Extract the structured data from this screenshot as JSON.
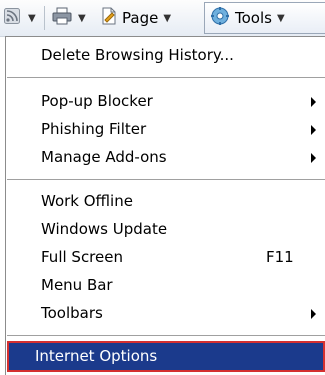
{
  "toolbar": {
    "feeds_icon": "rss-feed-icon",
    "print_icon": "printer-icon",
    "page_icon": "page-icon",
    "page_label": "Page",
    "tools_icon": "gear-icon",
    "tools_label": "Tools"
  },
  "menu": {
    "items": [
      {
        "label": "Delete Browsing History..."
      },
      {
        "label": "Pop-up Blocker"
      },
      {
        "label": "Phishing Filter"
      },
      {
        "label": "Manage Add-ons"
      },
      {
        "label": "Work Offline"
      },
      {
        "label": "Windows Update"
      },
      {
        "label": "Full Screen",
        "shortcut": "F11"
      },
      {
        "label": "Menu Bar"
      },
      {
        "label": "Toolbars"
      },
      {
        "label": "Internet Options"
      }
    ]
  },
  "colors": {
    "selection_bg": "#1b3a8c",
    "selection_border": "#d43030"
  }
}
